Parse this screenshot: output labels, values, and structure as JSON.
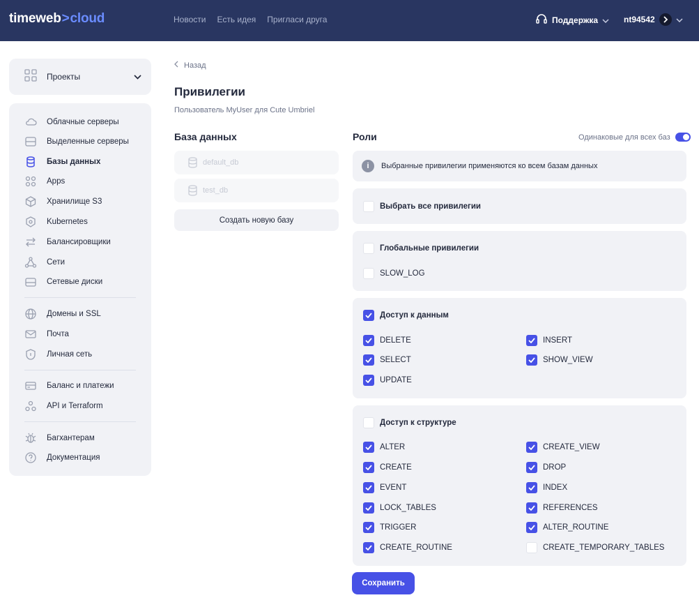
{
  "brand": {
    "part1": "timeweb",
    "arrow": ">",
    "part2": "cloud"
  },
  "topnav": [
    "Новости",
    "Есть идея",
    "Пригласи друга"
  ],
  "support": {
    "label": "Поддержка"
  },
  "user": {
    "name": "nt94542"
  },
  "sidebar": {
    "projects_label": "Проекты",
    "items": [
      {
        "label": "Облачные серверы",
        "icon": "cloud-icon"
      },
      {
        "label": "Выделенные серверы",
        "icon": "server-icon"
      },
      {
        "label": "Базы данных",
        "icon": "database-icon",
        "active": true
      },
      {
        "label": "Apps",
        "icon": "apps-icon"
      },
      {
        "label": "Хранилище S3",
        "icon": "cube-icon"
      },
      {
        "label": "Kubernetes",
        "icon": "kubernetes-icon"
      },
      {
        "label": "Балансировщики",
        "icon": "balancer-icon"
      },
      {
        "label": "Сети",
        "icon": "network-icon"
      },
      {
        "label": "Сетевые диски",
        "icon": "disk-icon"
      },
      {
        "label": "Домены и SSL",
        "icon": "globe-icon"
      },
      {
        "label": "Почта",
        "icon": "mail-icon"
      },
      {
        "label": "Личная сеть",
        "icon": "shield-icon"
      },
      {
        "label": "Баланс и платежи",
        "icon": "card-icon"
      },
      {
        "label": "API и Terraform",
        "icon": "api-icon"
      },
      {
        "label": "Багхантерам",
        "icon": "bug-icon"
      },
      {
        "label": "Документация",
        "icon": "help-icon"
      }
    ]
  },
  "page": {
    "back_label": "Назад",
    "title": "Привилегии",
    "subtitle": "Пользователь MyUser для Cute Umbriel",
    "db_section_title": "База данных",
    "roles_section_title": "Роли",
    "same_for_all_label": "Одинаковые для всех баз",
    "same_for_all_on": true,
    "databases": [
      "default_db",
      "test_db"
    ],
    "create_db_label": "Создать новую базу",
    "info_text": "Выбранные привилегии применяются ко всем базам данных",
    "select_all_label": "Выбрать все привилегии",
    "save_label": "Сохранить"
  },
  "groups": {
    "global": {
      "title": "Глобальные привилегии",
      "checked": false,
      "items": [
        {
          "label": "SLOW_LOG",
          "checked": false
        }
      ]
    },
    "data": {
      "title": "Доступ к данным",
      "checked": true,
      "items": [
        {
          "label": "DELETE",
          "checked": true
        },
        {
          "label": "INSERT",
          "checked": true
        },
        {
          "label": "SELECT",
          "checked": true
        },
        {
          "label": "SHOW_VIEW",
          "checked": true
        },
        {
          "label": "UPDATE",
          "checked": true
        }
      ]
    },
    "structure": {
      "title": "Доступ к структуре",
      "checked": false,
      "items": [
        {
          "label": "ALTER",
          "checked": true
        },
        {
          "label": "CREATE_VIEW",
          "checked": true
        },
        {
          "label": "CREATE",
          "checked": true
        },
        {
          "label": "DROP",
          "checked": true
        },
        {
          "label": "EVENT",
          "checked": true
        },
        {
          "label": "INDEX",
          "checked": true
        },
        {
          "label": "LOCK_TABLES",
          "checked": true
        },
        {
          "label": "REFERENCES",
          "checked": true
        },
        {
          "label": "TRIGGER",
          "checked": true
        },
        {
          "label": "ALTER_ROUTINE",
          "checked": true
        },
        {
          "label": "CREATE_ROUTINE",
          "checked": true
        },
        {
          "label": "CREATE_TEMPORARY_TABLES",
          "checked": false
        }
      ]
    }
  },
  "colors": {
    "header_bg": "#293661",
    "accent": "#4751e6",
    "panel_bg": "#f1f2f6"
  }
}
